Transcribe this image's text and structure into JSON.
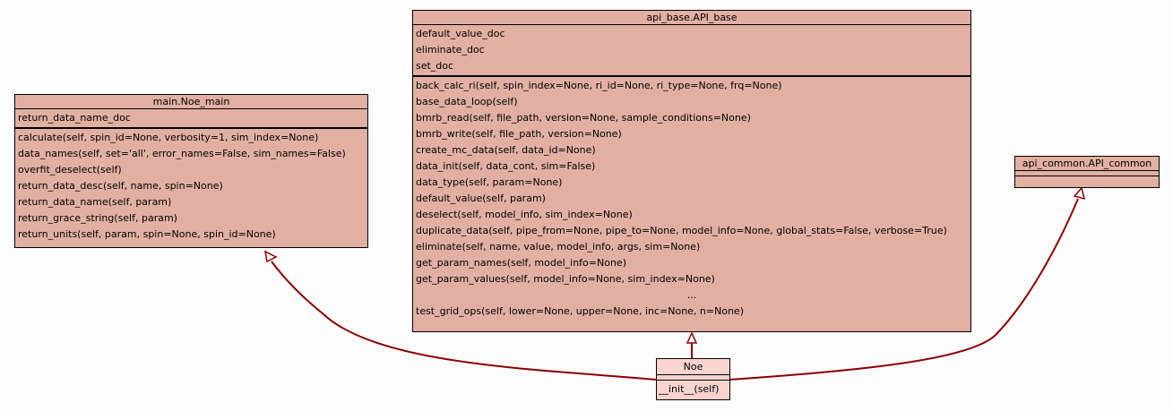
{
  "classes": {
    "noe_main": {
      "title": "main.Noe_main",
      "attributes": [
        "return_data_name_doc"
      ],
      "methods": [
        "calculate(self, spin_id=None, verbosity=1, sim_index=None)",
        "data_names(self, set='all', error_names=False, sim_names=False)",
        "overfit_deselect(self)",
        "return_data_desc(self, name, spin=None)",
        "return_data_name(self, param)",
        "return_grace_string(self, param)",
        "return_units(self, param, spin=None, spin_id=None)"
      ]
    },
    "api_base": {
      "title": "api_base.API_base",
      "attributes": [
        "default_value_doc",
        "eliminate_doc",
        "set_doc"
      ],
      "methods": [
        "back_calc_ri(self, spin_index=None, ri_id=None, ri_type=None, frq=None)",
        "base_data_loop(self)",
        "bmrb_read(self, file_path, version=None, sample_conditions=None)",
        "bmrb_write(self, file_path, version=None)",
        "create_mc_data(self, data_id=None)",
        "data_init(self, data_cont, sim=False)",
        "data_type(self, param=None)",
        "default_value(self, param)",
        "deselect(self, model_info, sim_index=None)",
        "duplicate_data(self, pipe_from=None, pipe_to=None, model_info=None, global_stats=False, verbose=True)",
        "eliminate(self, name, value, model_info, args, sim=None)",
        "get_param_names(self, model_info=None)",
        "get_param_values(self, model_info=None, sim_index=None)"
      ],
      "ellipsis": "...",
      "methods_after": [
        "test_grid_ops(self, lower=None, upper=None, inc=None, n=None)"
      ]
    },
    "api_common": {
      "title": "api_common.API_common"
    },
    "noe": {
      "title": "Noe",
      "methods": [
        "__init__(self)"
      ]
    }
  },
  "colors": {
    "class_fill": "#e2b0a3",
    "focus_class_fill": "#fad3cf",
    "edge": "#8b0000",
    "background": "#fcfcfc"
  }
}
